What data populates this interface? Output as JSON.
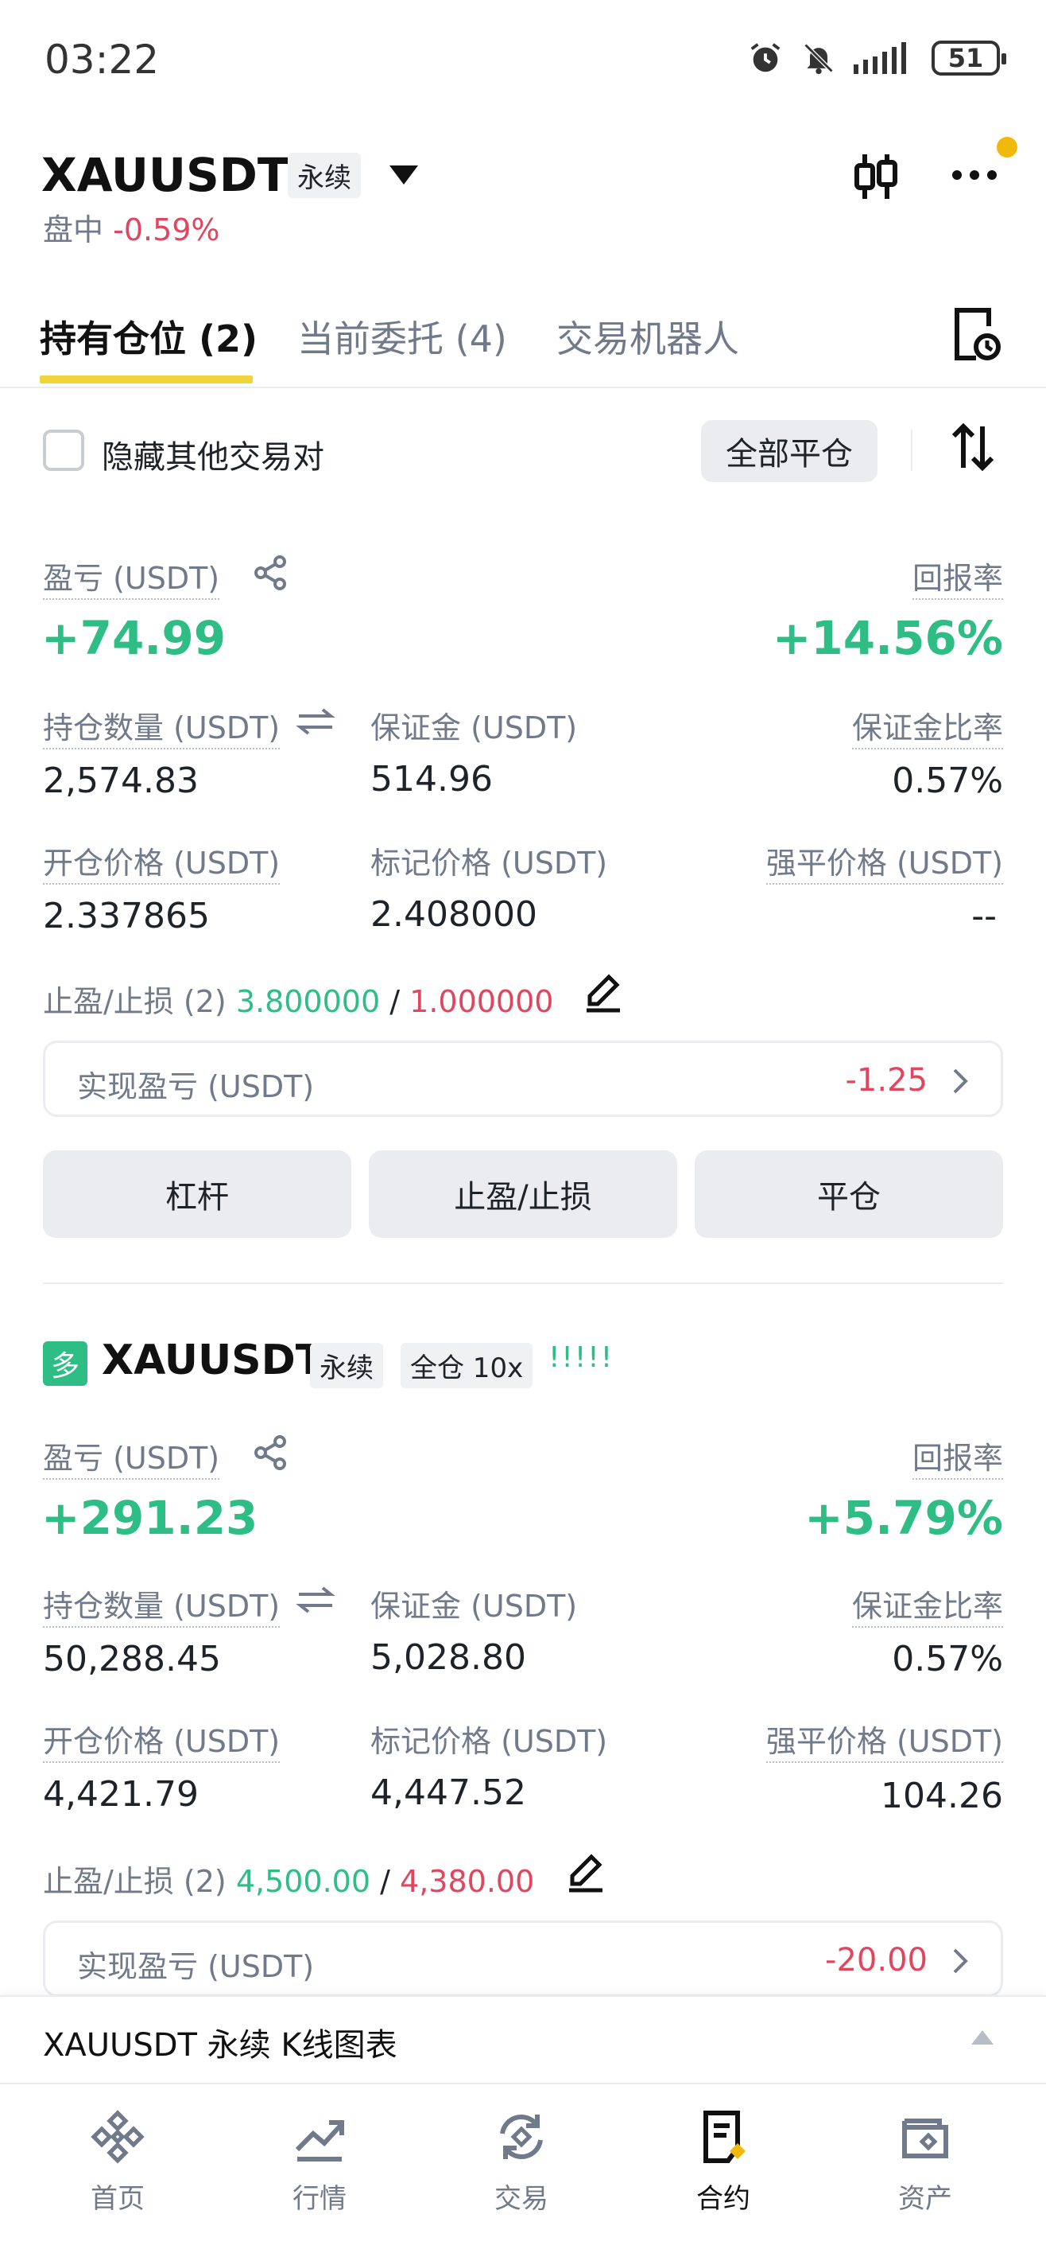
{
  "status_bar": {
    "time": "03:22",
    "battery": "51"
  },
  "header": {
    "symbol": "XAUUSDT",
    "type_tag": "永续",
    "session": "盘中",
    "change": "-0.59%"
  },
  "tabs": [
    {
      "label": "持有仓位 (2)"
    },
    {
      "label": "当前委托 (4)"
    },
    {
      "label": "交易机器人"
    }
  ],
  "filter": {
    "hide_label": "隐藏其他交易对",
    "close_all_label": "全部平仓"
  },
  "labels": {
    "pnl": "盈亏 (USDT)",
    "roe": "回报率",
    "size": "持仓数量 (USDT)",
    "margin": "保证金 (USDT)",
    "margin_ratio": "保证金比率",
    "entry_price": "开仓价格 (USDT)",
    "mark_price": "标记价格 (USDT)",
    "liq_price": "强平价格 (USDT)",
    "tpsl_prefix": "止盈/止损 (2)",
    "realized": "实现盈亏 (USDT)",
    "tpsl_sep": "/"
  },
  "actions": {
    "leverage": "杠杆",
    "tpsl": "止盈/止损",
    "close": "平仓"
  },
  "positions": [
    {
      "pnl": "+74.99",
      "roe": "+14.56%",
      "size": "2,574.83",
      "margin": "514.96",
      "margin_ratio": "0.57%",
      "entry_price": "2.337865",
      "mark_price": "2.408000",
      "liq_price": "--",
      "tp": "3.800000",
      "sl": "1.000000",
      "realized": "-1.25"
    },
    {
      "side_badge": "多",
      "symbol": "XAUUSDT",
      "type_tag": "永续",
      "margin_tag": "全仓 10x",
      "bars": "!!!!!",
      "pnl": "+291.23",
      "roe": "+5.79%",
      "size": "50,288.45",
      "margin": "5,028.80",
      "margin_ratio": "0.57%",
      "entry_price": "4,421.79",
      "mark_price": "4,447.52",
      "liq_price": "104.26",
      "tp": "4,500.00",
      "sl": "4,380.00",
      "realized": "-20.00"
    }
  ],
  "kline_drawer": {
    "title": "XAUUSDT 永续 K线图表"
  },
  "bottom_nav": [
    {
      "label": "首页",
      "icon": "binance-logo-icon"
    },
    {
      "label": "行情",
      "icon": "chart-icon"
    },
    {
      "label": "交易",
      "icon": "trade-icon"
    },
    {
      "label": "合约",
      "icon": "futures-icon"
    },
    {
      "label": "资产",
      "icon": "wallet-icon"
    }
  ],
  "colors": {
    "green": "#2ebd85",
    "red": "#e0465e",
    "accent": "#f0b90b"
  }
}
